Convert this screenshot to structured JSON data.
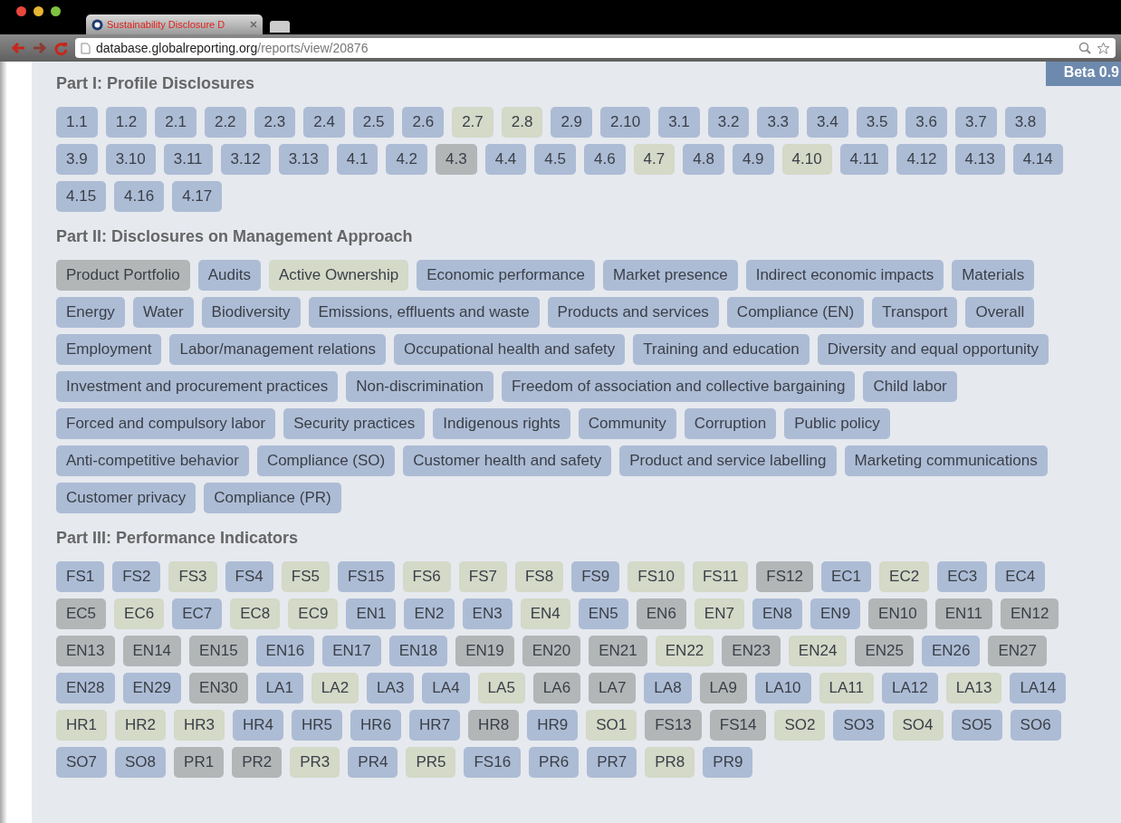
{
  "browser": {
    "tab_title": "Sustainability Disclosure D",
    "url_host": "database.globalreporting.org",
    "url_path": "/reports/view/20876"
  },
  "badge": "Beta 0.9",
  "sections": [
    {
      "title": "Part I: Profile Disclosures",
      "tags": [
        {
          "label": "1.1",
          "color": "#adbcd5"
        },
        {
          "label": "1.2",
          "color": "#adbcd5"
        },
        {
          "label": "2.1",
          "color": "#adbcd5"
        },
        {
          "label": "2.2",
          "color": "#adbcd5"
        },
        {
          "label": "2.3",
          "color": "#adbcd5"
        },
        {
          "label": "2.4",
          "color": "#adbcd5"
        },
        {
          "label": "2.5",
          "color": "#adbcd5"
        },
        {
          "label": "2.6",
          "color": "#adbcd5"
        },
        {
          "label": "2.7",
          "color": "#d4d9c8"
        },
        {
          "label": "2.8",
          "color": "#d4d9c8"
        },
        {
          "label": "2.9",
          "color": "#adbcd5"
        },
        {
          "label": "2.10",
          "color": "#adbcd5"
        },
        {
          "label": "3.1",
          "color": "#adbcd5"
        },
        {
          "label": "3.2",
          "color": "#adbcd5"
        },
        {
          "label": "3.3",
          "color": "#adbcd5"
        },
        {
          "label": "3.4",
          "color": "#adbcd5"
        },
        {
          "label": "3.5",
          "color": "#adbcd5"
        },
        {
          "label": "3.6",
          "color": "#adbcd5"
        },
        {
          "label": "3.7",
          "color": "#adbcd5"
        },
        {
          "label": "3.8",
          "color": "#adbcd5"
        },
        {
          "label": "3.9",
          "color": "#adbcd5"
        },
        {
          "label": "3.10",
          "color": "#adbcd5"
        },
        {
          "label": "3.11",
          "color": "#adbcd5"
        },
        {
          "label": "3.12",
          "color": "#adbcd5"
        },
        {
          "label": "3.13",
          "color": "#adbcd5"
        },
        {
          "label": "4.1",
          "color": "#adbcd5"
        },
        {
          "label": "4.2",
          "color": "#adbcd5"
        },
        {
          "label": "4.3",
          "color": "#b3b6b7"
        },
        {
          "label": "4.4",
          "color": "#adbcd5"
        },
        {
          "label": "4.5",
          "color": "#adbcd5"
        },
        {
          "label": "4.6",
          "color": "#adbcd5"
        },
        {
          "label": "4.7",
          "color": "#d4d9c8"
        },
        {
          "label": "4.8",
          "color": "#adbcd5"
        },
        {
          "label": "4.9",
          "color": "#adbcd5"
        },
        {
          "label": "4.10",
          "color": "#d4d9c8"
        },
        {
          "label": "4.11",
          "color": "#adbcd5"
        },
        {
          "label": "4.12",
          "color": "#adbcd5"
        },
        {
          "label": "4.13",
          "color": "#adbcd5"
        },
        {
          "label": "4.14",
          "color": "#adbcd5"
        },
        {
          "label": "4.15",
          "color": "#adbcd5"
        },
        {
          "label": "4.16",
          "color": "#adbcd5"
        },
        {
          "label": "4.17",
          "color": "#adbcd5"
        }
      ]
    },
    {
      "title": "Part II: Disclosures on Management Approach",
      "tags": [
        {
          "label": "Product Portfolio",
          "color": "#b3b6b7"
        },
        {
          "label": "Audits",
          "color": "#adbcd5"
        },
        {
          "label": "Active Ownership",
          "color": "#d4d9c8"
        },
        {
          "label": "Economic performance",
          "color": "#adbcd5"
        },
        {
          "label": "Market presence",
          "color": "#adbcd5"
        },
        {
          "label": "Indirect economic impacts",
          "color": "#adbcd5"
        },
        {
          "label": "Materials",
          "color": "#adbcd5"
        },
        {
          "label": "Energy",
          "color": "#adbcd5"
        },
        {
          "label": "Water",
          "color": "#adbcd5"
        },
        {
          "label": "Biodiversity",
          "color": "#adbcd5"
        },
        {
          "label": "Emissions, effluents and waste",
          "color": "#adbcd5"
        },
        {
          "label": "Products and services",
          "color": "#adbcd5"
        },
        {
          "label": "Compliance (EN)",
          "color": "#adbcd5"
        },
        {
          "label": "Transport",
          "color": "#adbcd5"
        },
        {
          "label": "Overall",
          "color": "#adbcd5"
        },
        {
          "label": "Employment",
          "color": "#adbcd5"
        },
        {
          "label": "Labor/management relations",
          "color": "#adbcd5"
        },
        {
          "label": "Occupational health and safety",
          "color": "#adbcd5"
        },
        {
          "label": "Training and education",
          "color": "#adbcd5"
        },
        {
          "label": "Diversity and equal opportunity",
          "color": "#adbcd5"
        },
        {
          "label": "Investment and procurement practices",
          "color": "#adbcd5"
        },
        {
          "label": "Non-discrimination",
          "color": "#adbcd5"
        },
        {
          "label": "Freedom of association and collective bargaining",
          "color": "#adbcd5"
        },
        {
          "label": "Child labor",
          "color": "#adbcd5"
        },
        {
          "label": "Forced and compulsory labor",
          "color": "#adbcd5"
        },
        {
          "label": "Security practices",
          "color": "#adbcd5"
        },
        {
          "label": "Indigenous rights",
          "color": "#adbcd5"
        },
        {
          "label": "Community",
          "color": "#adbcd5"
        },
        {
          "label": "Corruption",
          "color": "#adbcd5"
        },
        {
          "label": "Public policy",
          "color": "#adbcd5"
        },
        {
          "label": "Anti-competitive behavior",
          "color": "#adbcd5"
        },
        {
          "label": "Compliance (SO)",
          "color": "#adbcd5"
        },
        {
          "label": "Customer health and safety",
          "color": "#adbcd5"
        },
        {
          "label": "Product and service labelling",
          "color": "#adbcd5"
        },
        {
          "label": "Marketing communications",
          "color": "#adbcd5"
        },
        {
          "label": "Customer privacy",
          "color": "#adbcd5"
        },
        {
          "label": "Compliance (PR)",
          "color": "#adbcd5"
        }
      ]
    },
    {
      "title": "Part III: Performance Indicators",
      "tags": [
        {
          "label": "FS1",
          "color": "#adbcd5"
        },
        {
          "label": "FS2",
          "color": "#adbcd5"
        },
        {
          "label": "FS3",
          "color": "#d4d9c8"
        },
        {
          "label": "FS4",
          "color": "#adbcd5"
        },
        {
          "label": "FS5",
          "color": "#d4d9c8"
        },
        {
          "label": "FS15",
          "color": "#adbcd5"
        },
        {
          "label": "FS6",
          "color": "#d4d9c8"
        },
        {
          "label": "FS7",
          "color": "#d4d9c8"
        },
        {
          "label": "FS8",
          "color": "#d4d9c8"
        },
        {
          "label": "FS9",
          "color": "#adbcd5"
        },
        {
          "label": "FS10",
          "color": "#d4d9c8"
        },
        {
          "label": "FS11",
          "color": "#d4d9c8"
        },
        {
          "label": "FS12",
          "color": "#b3b6b7"
        },
        {
          "label": "EC1",
          "color": "#adbcd5"
        },
        {
          "label": "EC2",
          "color": "#d4d9c8"
        },
        {
          "label": "EC3",
          "color": "#adbcd5"
        },
        {
          "label": "EC4",
          "color": "#adbcd5"
        },
        {
          "label": "EC5",
          "color": "#b3b6b7"
        },
        {
          "label": "EC6",
          "color": "#d4d9c8"
        },
        {
          "label": "EC7",
          "color": "#adbcd5"
        },
        {
          "label": "EC8",
          "color": "#d4d9c8"
        },
        {
          "label": "EC9",
          "color": "#d4d9c8"
        },
        {
          "label": "EN1",
          "color": "#adbcd5"
        },
        {
          "label": "EN2",
          "color": "#adbcd5"
        },
        {
          "label": "EN3",
          "color": "#adbcd5"
        },
        {
          "label": "EN4",
          "color": "#d4d9c8"
        },
        {
          "label": "EN5",
          "color": "#adbcd5"
        },
        {
          "label": "EN6",
          "color": "#b3b6b7"
        },
        {
          "label": "EN7",
          "color": "#d4d9c8"
        },
        {
          "label": "EN8",
          "color": "#adbcd5"
        },
        {
          "label": "EN9",
          "color": "#adbcd5"
        },
        {
          "label": "EN10",
          "color": "#b3b6b7"
        },
        {
          "label": "EN11",
          "color": "#b3b6b7"
        },
        {
          "label": "EN12",
          "color": "#b3b6b7"
        },
        {
          "label": "EN13",
          "color": "#b3b6b7"
        },
        {
          "label": "EN14",
          "color": "#b3b6b7"
        },
        {
          "label": "EN15",
          "color": "#b3b6b7"
        },
        {
          "label": "EN16",
          "color": "#adbcd5"
        },
        {
          "label": "EN17",
          "color": "#adbcd5"
        },
        {
          "label": "EN18",
          "color": "#adbcd5"
        },
        {
          "label": "EN19",
          "color": "#b3b6b7"
        },
        {
          "label": "EN20",
          "color": "#b3b6b7"
        },
        {
          "label": "EN21",
          "color": "#b3b6b7"
        },
        {
          "label": "EN22",
          "color": "#d4d9c8"
        },
        {
          "label": "EN23",
          "color": "#b3b6b7"
        },
        {
          "label": "EN24",
          "color": "#d4d9c8"
        },
        {
          "label": "EN25",
          "color": "#b3b6b7"
        },
        {
          "label": "EN26",
          "color": "#adbcd5"
        },
        {
          "label": "EN27",
          "color": "#b3b6b7"
        },
        {
          "label": "EN28",
          "color": "#adbcd5"
        },
        {
          "label": "EN29",
          "color": "#adbcd5"
        },
        {
          "label": "EN30",
          "color": "#b3b6b7"
        },
        {
          "label": "LA1",
          "color": "#adbcd5"
        },
        {
          "label": "LA2",
          "color": "#d4d9c8"
        },
        {
          "label": "LA3",
          "color": "#adbcd5"
        },
        {
          "label": "LA4",
          "color": "#adbcd5"
        },
        {
          "label": "LA5",
          "color": "#d4d9c8"
        },
        {
          "label": "LA6",
          "color": "#b3b6b7"
        },
        {
          "label": "LA7",
          "color": "#b3b6b7"
        },
        {
          "label": "LA8",
          "color": "#adbcd5"
        },
        {
          "label": "LA9",
          "color": "#b3b6b7"
        },
        {
          "label": "LA10",
          "color": "#adbcd5"
        },
        {
          "label": "LA11",
          "color": "#d4d9c8"
        },
        {
          "label": "LA12",
          "color": "#adbcd5"
        },
        {
          "label": "LA13",
          "color": "#d4d9c8"
        },
        {
          "label": "LA14",
          "color": "#adbcd5"
        },
        {
          "label": "HR1",
          "color": "#d4d9c8"
        },
        {
          "label": "HR2",
          "color": "#d4d9c8"
        },
        {
          "label": "HR3",
          "color": "#d4d9c8"
        },
        {
          "label": "HR4",
          "color": "#adbcd5"
        },
        {
          "label": "HR5",
          "color": "#adbcd5"
        },
        {
          "label": "HR6",
          "color": "#adbcd5"
        },
        {
          "label": "HR7",
          "color": "#adbcd5"
        },
        {
          "label": "HR8",
          "color": "#b3b6b7"
        },
        {
          "label": "HR9",
          "color": "#adbcd5"
        },
        {
          "label": "SO1",
          "color": "#d4d9c8"
        },
        {
          "label": "FS13",
          "color": "#b3b6b7"
        },
        {
          "label": "FS14",
          "color": "#b3b6b7"
        },
        {
          "label": "SO2",
          "color": "#d4d9c8"
        },
        {
          "label": "SO3",
          "color": "#adbcd5"
        },
        {
          "label": "SO4",
          "color": "#d4d9c8"
        },
        {
          "label": "SO5",
          "color": "#adbcd5"
        },
        {
          "label": "SO6",
          "color": "#adbcd5"
        },
        {
          "label": "SO7",
          "color": "#adbcd5"
        },
        {
          "label": "SO8",
          "color": "#adbcd5"
        },
        {
          "label": "PR1",
          "color": "#b3b6b7"
        },
        {
          "label": "PR2",
          "color": "#b3b6b7"
        },
        {
          "label": "PR3",
          "color": "#d4d9c8"
        },
        {
          "label": "PR4",
          "color": "#adbcd5"
        },
        {
          "label": "PR5",
          "color": "#d4d9c8"
        },
        {
          "label": "FS16",
          "color": "#adbcd5"
        },
        {
          "label": "PR6",
          "color": "#adbcd5"
        },
        {
          "label": "PR7",
          "color": "#adbcd5"
        },
        {
          "label": "PR8",
          "color": "#d4d9c8"
        },
        {
          "label": "PR9",
          "color": "#adbcd5"
        }
      ]
    }
  ]
}
